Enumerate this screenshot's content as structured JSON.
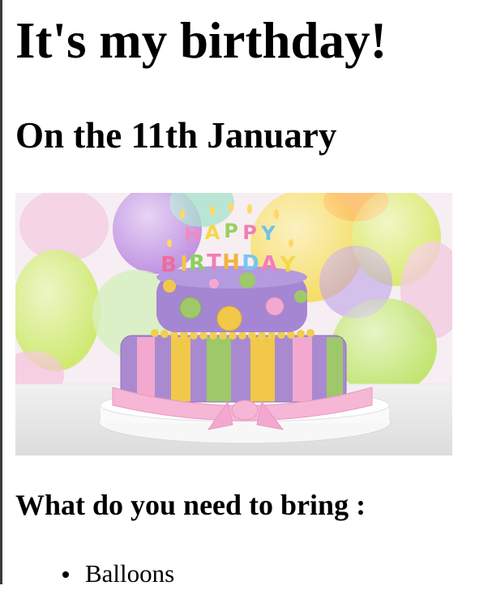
{
  "page": {
    "title": "It's my birthday!",
    "subtitle": "On the 11th January",
    "image": {
      "description_name": "birthday-cake-photo",
      "cake_lettering_top": "HAPPY",
      "cake_lettering_bottom": "BIRTHDAY"
    },
    "bring_heading": "What do you need to bring :",
    "bring_items": [
      "Balloons"
    ]
  },
  "colors": {
    "background": "#ffffff",
    "text": "#000000",
    "cake_purple": "#a98ad0",
    "cake_pink": "#f3a9cf",
    "cake_yellow": "#f2c84a",
    "cake_green": "#9ec86a"
  }
}
